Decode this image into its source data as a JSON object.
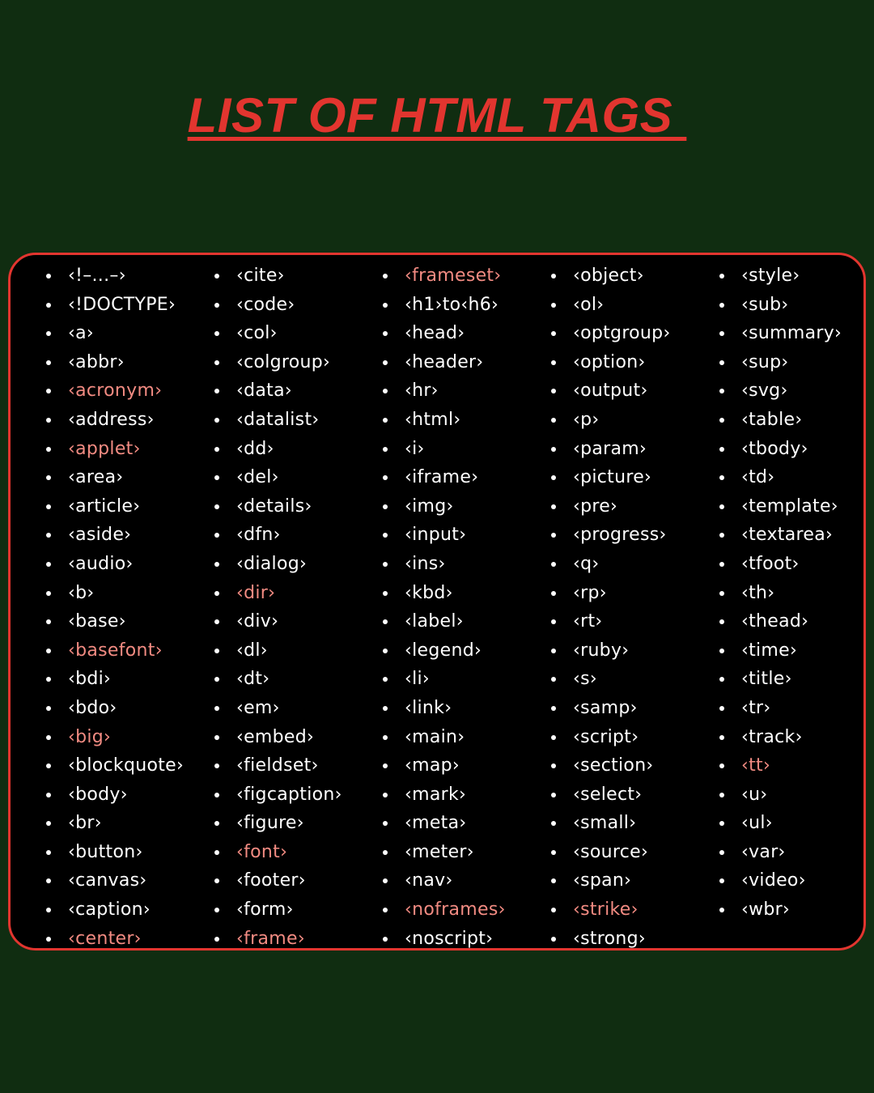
{
  "title": "LIST OF HTML TAGS ",
  "colors": {
    "background": "#102d11",
    "panel": "#000000",
    "accent": "#e2352f",
    "deprecated_tag": "#f28b82",
    "normal_tag": "#ffffff"
  },
  "columns": [
    [
      {
        "label": "‹!–...–›",
        "deprecated": false
      },
      {
        "label": "‹!DOCTYPE›",
        "deprecated": false
      },
      {
        "label": "‹a›",
        "deprecated": false
      },
      {
        "label": "‹abbr›",
        "deprecated": false
      },
      {
        "label": "‹acronym›",
        "deprecated": true
      },
      {
        "label": "‹address›",
        "deprecated": false
      },
      {
        "label": "‹applet›",
        "deprecated": true
      },
      {
        "label": "‹area›",
        "deprecated": false
      },
      {
        "label": "‹article›",
        "deprecated": false
      },
      {
        "label": "‹aside›",
        "deprecated": false
      },
      {
        "label": "‹audio›",
        "deprecated": false
      },
      {
        "label": "‹b›",
        "deprecated": false
      },
      {
        "label": "‹base›",
        "deprecated": false
      },
      {
        "label": "‹basefont›",
        "deprecated": true
      },
      {
        "label": "‹bdi›",
        "deprecated": false
      },
      {
        "label": "‹bdo›",
        "deprecated": false
      },
      {
        "label": "‹big›",
        "deprecated": true
      },
      {
        "label": "‹blockquote›",
        "deprecated": false
      },
      {
        "label": "‹body›",
        "deprecated": false
      },
      {
        "label": "‹br›",
        "deprecated": false
      },
      {
        "label": "‹button›",
        "deprecated": false
      },
      {
        "label": "‹canvas›",
        "deprecated": false
      },
      {
        "label": "‹caption›",
        "deprecated": false
      },
      {
        "label": "‹center›",
        "deprecated": true
      }
    ],
    [
      {
        "label": "‹cite›",
        "deprecated": false
      },
      {
        "label": "‹code›",
        "deprecated": false
      },
      {
        "label": "‹col›",
        "deprecated": false
      },
      {
        "label": "‹colgroup›",
        "deprecated": false
      },
      {
        "label": "‹data›",
        "deprecated": false
      },
      {
        "label": "‹datalist›",
        "deprecated": false
      },
      {
        "label": "‹dd›",
        "deprecated": false
      },
      {
        "label": "‹del›",
        "deprecated": false
      },
      {
        "label": "‹details›",
        "deprecated": false
      },
      {
        "label": "‹dfn›",
        "deprecated": false
      },
      {
        "label": "‹dialog›",
        "deprecated": false
      },
      {
        "label": "‹dir›",
        "deprecated": true
      },
      {
        "label": "‹div›",
        "deprecated": false
      },
      {
        "label": "‹dl›",
        "deprecated": false
      },
      {
        "label": "‹dt›",
        "deprecated": false
      },
      {
        "label": "‹em›",
        "deprecated": false
      },
      {
        "label": "‹embed›",
        "deprecated": false
      },
      {
        "label": "‹fieldset›",
        "deprecated": false
      },
      {
        "label": "‹figcaption›",
        "deprecated": false
      },
      {
        "label": "‹figure›",
        "deprecated": false
      },
      {
        "label": "‹font›",
        "deprecated": true
      },
      {
        "label": "‹footer›",
        "deprecated": false
      },
      {
        "label": "‹form›",
        "deprecated": false
      },
      {
        "label": "‹frame›",
        "deprecated": true
      }
    ],
    [
      {
        "label": "‹frameset›",
        "deprecated": true
      },
      {
        "label": "‹h1›to‹h6›",
        "deprecated": false
      },
      {
        "label": "‹head›",
        "deprecated": false
      },
      {
        "label": "‹header›",
        "deprecated": false
      },
      {
        "label": "‹hr›",
        "deprecated": false
      },
      {
        "label": "‹html›",
        "deprecated": false
      },
      {
        "label": "‹i›",
        "deprecated": false
      },
      {
        "label": "‹iframe›",
        "deprecated": false
      },
      {
        "label": "‹img›",
        "deprecated": false
      },
      {
        "label": "‹input›",
        "deprecated": false
      },
      {
        "label": "‹ins›",
        "deprecated": false
      },
      {
        "label": "‹kbd›",
        "deprecated": false
      },
      {
        "label": "‹label›",
        "deprecated": false
      },
      {
        "label": "‹legend›",
        "deprecated": false
      },
      {
        "label": "‹li›",
        "deprecated": false
      },
      {
        "label": "‹link›",
        "deprecated": false
      },
      {
        "label": "‹main›",
        "deprecated": false
      },
      {
        "label": "‹map›",
        "deprecated": false
      },
      {
        "label": "‹mark›",
        "deprecated": false
      },
      {
        "label": "‹meta›",
        "deprecated": false
      },
      {
        "label": "‹meter›",
        "deprecated": false
      },
      {
        "label": "‹nav›",
        "deprecated": false
      },
      {
        "label": "‹noframes›",
        "deprecated": true
      },
      {
        "label": "‹noscript›",
        "deprecated": false
      }
    ],
    [
      {
        "label": "‹object›",
        "deprecated": false
      },
      {
        "label": "‹ol›",
        "deprecated": false
      },
      {
        "label": "‹optgroup›",
        "deprecated": false
      },
      {
        "label": "‹option›",
        "deprecated": false
      },
      {
        "label": "‹output›",
        "deprecated": false
      },
      {
        "label": "‹p›",
        "deprecated": false
      },
      {
        "label": "‹param›",
        "deprecated": false
      },
      {
        "label": "‹picture›",
        "deprecated": false
      },
      {
        "label": "‹pre›",
        "deprecated": false
      },
      {
        "label": "‹progress›",
        "deprecated": false
      },
      {
        "label": "‹q›",
        "deprecated": false
      },
      {
        "label": "‹rp›",
        "deprecated": false
      },
      {
        "label": "‹rt›",
        "deprecated": false
      },
      {
        "label": "‹ruby›",
        "deprecated": false
      },
      {
        "label": "‹s›",
        "deprecated": false
      },
      {
        "label": "‹samp›",
        "deprecated": false
      },
      {
        "label": "‹script›",
        "deprecated": false
      },
      {
        "label": "‹section›",
        "deprecated": false
      },
      {
        "label": "‹select›",
        "deprecated": false
      },
      {
        "label": "‹small›",
        "deprecated": false
      },
      {
        "label": "‹source›",
        "deprecated": false
      },
      {
        "label": "‹span›",
        "deprecated": false
      },
      {
        "label": "‹strike›",
        "deprecated": true
      },
      {
        "label": "‹strong›",
        "deprecated": false
      }
    ],
    [
      {
        "label": "‹style›",
        "deprecated": false
      },
      {
        "label": "‹sub›",
        "deprecated": false
      },
      {
        "label": "‹summary›",
        "deprecated": false
      },
      {
        "label": "‹sup›",
        "deprecated": false
      },
      {
        "label": "‹svg›",
        "deprecated": false
      },
      {
        "label": "‹table›",
        "deprecated": false
      },
      {
        "label": "‹tbody›",
        "deprecated": false
      },
      {
        "label": "‹td›",
        "deprecated": false
      },
      {
        "label": "‹template›",
        "deprecated": false
      },
      {
        "label": "‹textarea›",
        "deprecated": false
      },
      {
        "label": "‹tfoot›",
        "deprecated": false
      },
      {
        "label": "‹th›",
        "deprecated": false
      },
      {
        "label": "‹thead›",
        "deprecated": false
      },
      {
        "label": "‹time›",
        "deprecated": false
      },
      {
        "label": "‹title›",
        "deprecated": false
      },
      {
        "label": "‹tr›",
        "deprecated": false
      },
      {
        "label": "‹track›",
        "deprecated": false
      },
      {
        "label": "‹tt›",
        "deprecated": true
      },
      {
        "label": "‹u›",
        "deprecated": false
      },
      {
        "label": "‹ul›",
        "deprecated": false
      },
      {
        "label": "‹var›",
        "deprecated": false
      },
      {
        "label": "‹video›",
        "deprecated": false
      },
      {
        "label": "‹wbr›",
        "deprecated": false
      }
    ]
  ]
}
